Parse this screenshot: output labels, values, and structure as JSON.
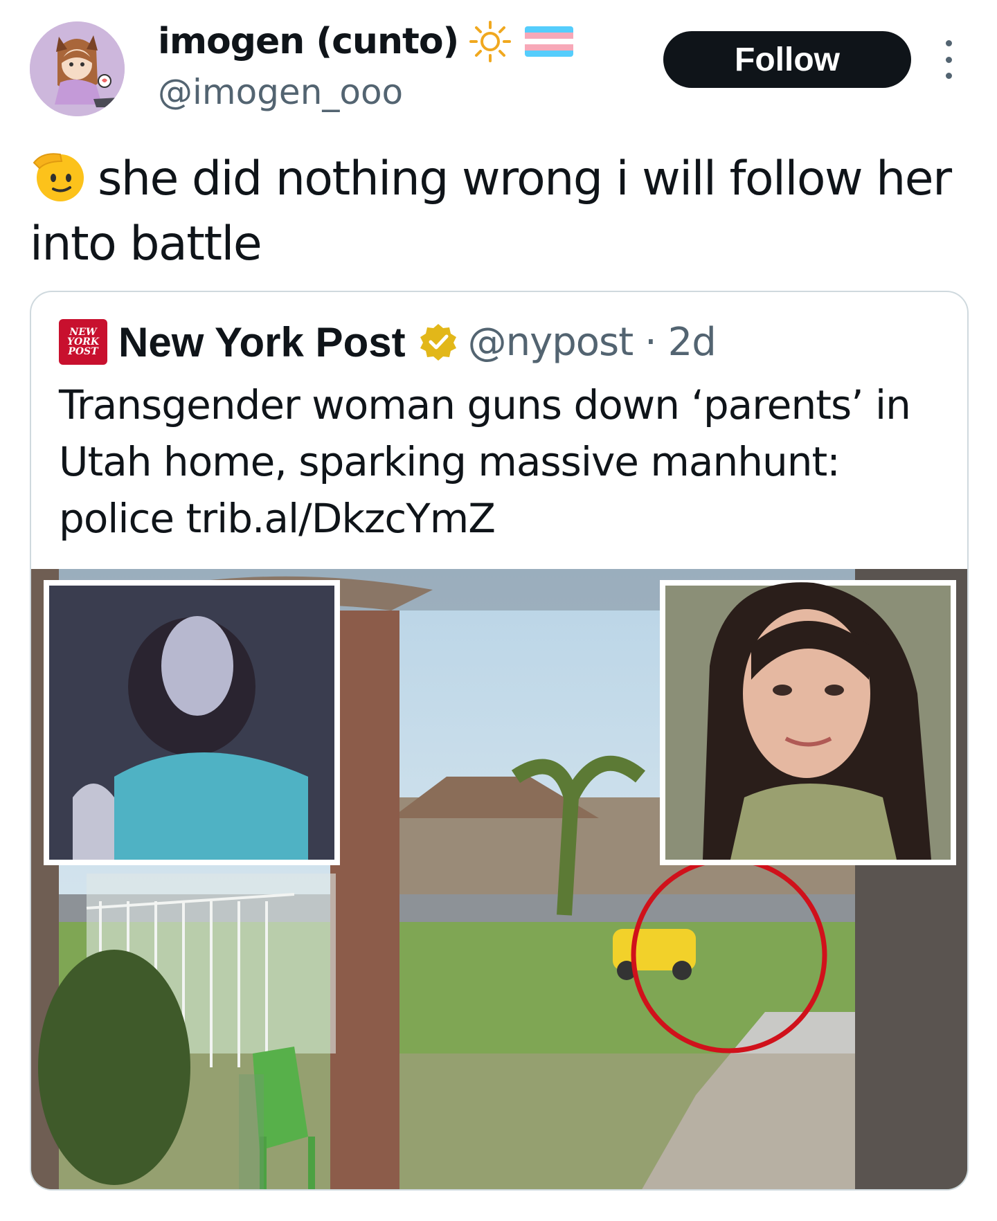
{
  "post": {
    "author": {
      "display_name": "imogen (cunto)",
      "handle": "@imogen_ooo",
      "name_emojis": [
        "sun-icon",
        "trans-flag-icon"
      ]
    },
    "follow_label": "Follow",
    "text_emoji": "saluting-face-icon",
    "text": "she did nothing wrong i will follow her into battle"
  },
  "quote": {
    "source_logo_lines": [
      "NEW",
      "YORK",
      "POST"
    ],
    "display_name": "New York Post",
    "handle_time": "@nypost · 2d",
    "text": "Transgender woman guns down ‘parents’ in Utah home, sparking massive manhunt: police trib.al/DkzcYmZ"
  },
  "colors": {
    "follow_bg": "#0f1419",
    "handle_gray": "#536471",
    "verified_gold": "#e2b719",
    "nyp_red": "#c8102e",
    "highlight_circle": "#d0111b"
  }
}
